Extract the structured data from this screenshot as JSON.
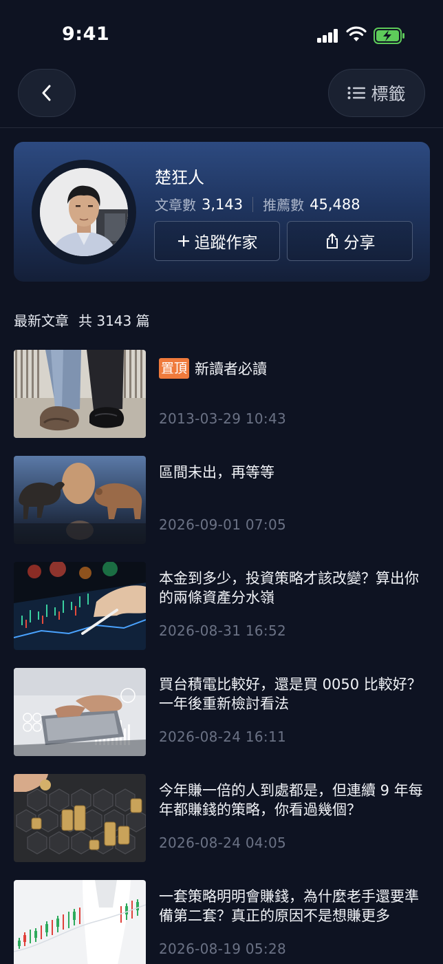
{
  "status_bar": {
    "time": "9:41"
  },
  "nav": {
    "tags_label": "標籤"
  },
  "profile": {
    "name": "楚狂人",
    "articles_label": "文章數",
    "articles_count": "3,143",
    "recommend_label": "推薦數",
    "recommend_count": "45,488",
    "follow_label": "追蹤作家",
    "share_label": "分享"
  },
  "section": {
    "title": "最新文章",
    "count_text": "共 3143 篇"
  },
  "articles": [
    {
      "badge": "置頂",
      "title": "新讀者必讀",
      "date": "2013-03-29 10:43",
      "thumb": "shoes-photo"
    },
    {
      "title": "區間未出，再等等",
      "date": "2026-09-01 07:05",
      "thumb": "bull-bear-photo"
    },
    {
      "title": "本金到多少，投資策略才該改變？算出你的兩條資產分水嶺",
      "date": "2026-08-31 16:52",
      "thumb": "stock-tablet-photo"
    },
    {
      "title": "買台積電比較好，還是買 0050 比較好？一年後重新檢討看法",
      "date": "2026-08-24 16:11",
      "thumb": "laptop-finance-photo"
    },
    {
      "title": "今年賺一倍的人到處都是，但連續 9 年每年都賺錢的策略，你看過幾個？",
      "date": "2026-08-24 04:05",
      "thumb": "coin-stacks-photo"
    },
    {
      "title": "一套策略明明會賺錢，為什麼老手還要準備第二套？真正的原因不是想賺更多",
      "date": "2026-08-19 05:28",
      "thumb": "candlestick-photo"
    }
  ]
}
